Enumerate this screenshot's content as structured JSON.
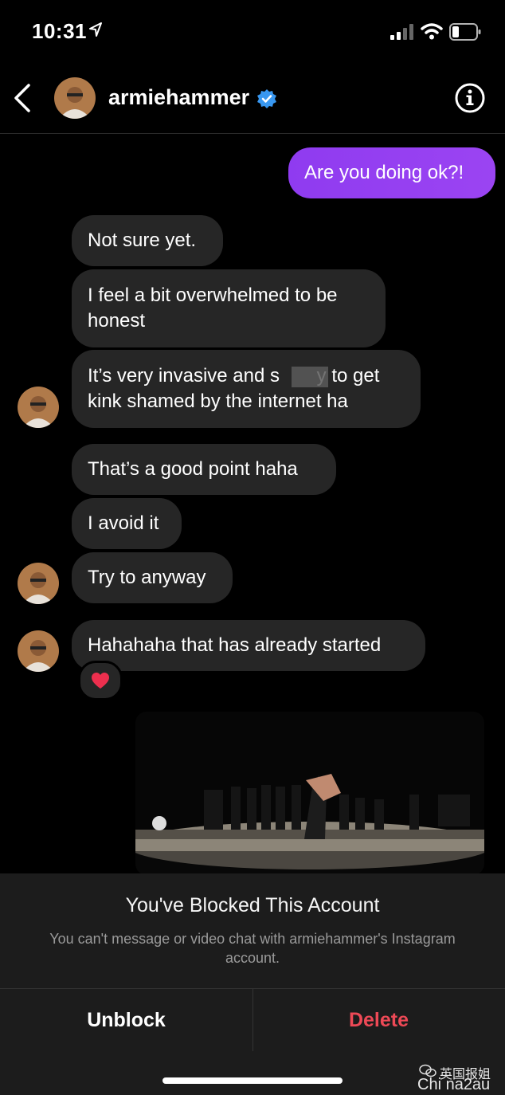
{
  "status_bar": {
    "time": "10:31"
  },
  "header": {
    "username": "armiehammer"
  },
  "messages": [
    {
      "text": "Are you doing ok?!"
    },
    {
      "text": "Not sure yet."
    },
    {
      "text": "I feel a bit overwhelmed to be honest"
    },
    {
      "text": "It’s very invasive and s       y to get kink shamed by the internet ha"
    },
    {
      "text": "That’s a good point haha"
    },
    {
      "text": "I avoid it"
    },
    {
      "text": "Try to anyway"
    },
    {
      "text": "Hahahaha that has already started"
    }
  ],
  "reaction": "❤️",
  "blocked_panel": {
    "title": "You've Blocked This Account",
    "description": "You can't message or video chat with armiehammer's Instagram account.",
    "unblock_label": "Unblock",
    "delete_label": "Delete"
  },
  "watermark": {
    "line1": "英国报姐",
    "line2": "Chi na2au"
  },
  "colors": {
    "outgoing_bubble": "#9b44f2",
    "incoming_bubble": "#262626",
    "delete": "#ed4956",
    "verified": "#3897f0"
  }
}
